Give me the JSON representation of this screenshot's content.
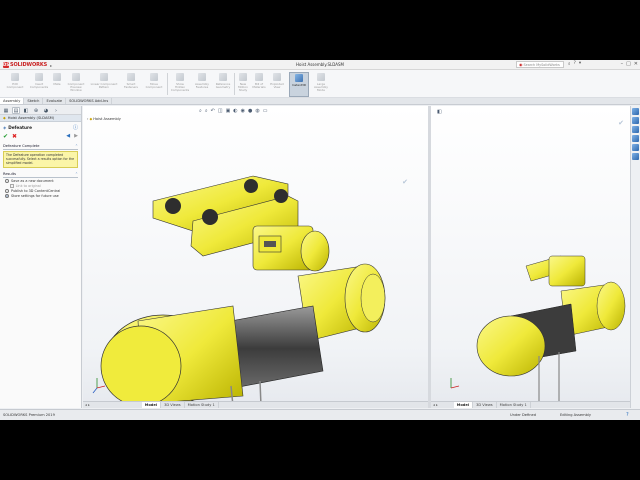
{
  "window": {
    "title": "Hoist Assembly.SLDASM",
    "brand": "SOLIDWORKS",
    "search_placeholder": "Search MySolidWorks"
  },
  "ribbon": {
    "items": [
      {
        "label": "Edit\nComponent"
      },
      {
        "label": "Insert\nComponents"
      },
      {
        "label": "Mate"
      },
      {
        "label": "Component\nPreview\nWindow"
      },
      {
        "label": "Linear Component\nPattern"
      },
      {
        "label": "Smart\nFasteners"
      },
      {
        "label": "Move\nComponent"
      },
      {
        "label": "Show\nHidden\nComponents"
      },
      {
        "label": "Assembly\nFeatures"
      },
      {
        "label": "Reference\nGeometry"
      },
      {
        "label": "New\nMotion\nStudy"
      },
      {
        "label": "Bill of\nMaterials"
      },
      {
        "label": "Exploded\nView"
      },
      {
        "label": "Instant3D"
      },
      {
        "label": "Large\nAssembly\nMode"
      }
    ],
    "active_index": 13
  },
  "tabs": [
    "Assembly",
    "Sketch",
    "Evaluate",
    "SOLIDWORKS Add-Ins"
  ],
  "active_tab": "Assembly",
  "property_manager": {
    "doc_name": "Hoist Assembly (SLDASM)",
    "feature_title": "Defeature",
    "message_section": "Defeature Complete",
    "message": "The Defeature operation completed successfully. Select a results option for the simplified model.",
    "results_section": "Results",
    "options": [
      {
        "label": "Save as a new document",
        "selected": false,
        "disabled": false
      },
      {
        "label": "Link to original",
        "checkbox": true,
        "disabled": true
      },
      {
        "label": "Publish to 3D ContentCentral",
        "selected": false,
        "disabled": false
      },
      {
        "label": "Store settings for future use",
        "selected": true,
        "disabled": false
      }
    ]
  },
  "viewport_left": {
    "tree_label": "Hoist Assembly"
  },
  "model_tabs": [
    "Model",
    "3D Views",
    "Motion Study 1"
  ],
  "status": {
    "left": "SOLIDWORKS Premium 2019",
    "definition": "Under Defined",
    "mode": "Editing Assembly"
  },
  "colors": {
    "hoist_yellow": "#f2ee3a",
    "accent_red": "#c82020",
    "selection_blue": "#2d67ad"
  }
}
